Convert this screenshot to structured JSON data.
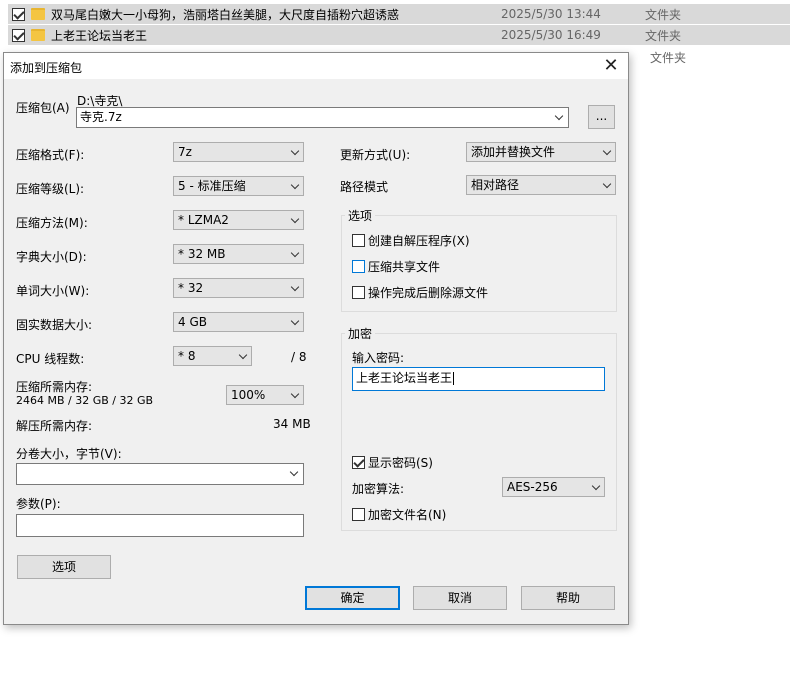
{
  "file_list": {
    "rows": [
      {
        "name": "双马尾白嫩大一小母狗，浩丽塔白丝美腿，大尺度自插粉穴超诱惑",
        "date": "2025/5/30 13:44",
        "type": "文件夹"
      },
      {
        "name": "上老王论坛当老王",
        "date": "2025/5/30 16:49",
        "type": "文件夹"
      }
    ],
    "partial_row_type": "文件夹"
  },
  "dialog": {
    "title": "添加到压缩包",
    "close_glyph": "✕",
    "archive": {
      "label": "压缩包(A)",
      "path": "D:\\寺克\\",
      "filename": "寺克.7z",
      "browse_label": "..."
    },
    "left": {
      "format": {
        "label": "压缩格式(F):",
        "value": "7z"
      },
      "level": {
        "label": "压缩等级(L):",
        "value": "5 - 标准压缩"
      },
      "method": {
        "label": "压缩方法(M):",
        "value": "* LZMA2"
      },
      "dict": {
        "label": "字典大小(D):",
        "value": "* 32 MB"
      },
      "word": {
        "label": "单词大小(W):",
        "value": "* 32"
      },
      "solid": {
        "label": "固实数据大小:",
        "value": "4 GB"
      },
      "cpu": {
        "label": "CPU 线程数:",
        "value": "* 8",
        "max": "/ 8"
      },
      "mem_compress": {
        "label": "压缩所需内存:",
        "detail": "2464 MB / 32 GB / 32 GB",
        "value": "100%"
      },
      "mem_decompress": {
        "label": "解压所需内存:",
        "value": "34 MB"
      },
      "split": {
        "label": "分卷大小，字节(V):",
        "value": ""
      },
      "params": {
        "label": "参数(P):",
        "value": ""
      },
      "options_button": "选项"
    },
    "right": {
      "update": {
        "label": "更新方式(U):",
        "value": "添加并替换文件"
      },
      "path_mode": {
        "label": "路径模式",
        "value": "相对路径"
      },
      "options_group": {
        "title": "选项",
        "sfx": "创建自解压程序(X)",
        "shared": "压缩共享文件",
        "delete": "操作完成后删除源文件"
      },
      "encryption": {
        "title": "加密",
        "password_label": "输入密码:",
        "password_value": "上老王论坛当老王",
        "show_password": "显示密码(S)",
        "algorithm_label": "加密算法:",
        "algorithm_value": "AES-256",
        "encrypt_names": "加密文件名(N)"
      }
    },
    "buttons": {
      "ok": "确定",
      "cancel": "取消",
      "help": "帮助"
    }
  }
}
